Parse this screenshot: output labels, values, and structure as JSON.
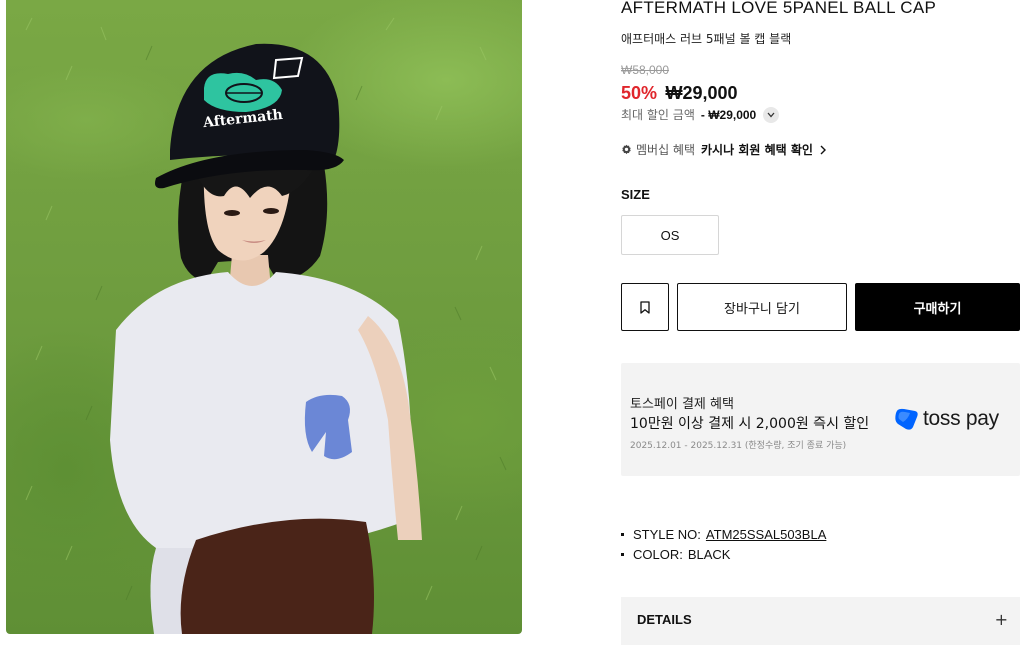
{
  "product": {
    "title": "AFTERMATH LOVE 5PANEL BALL CAP",
    "subtitle": "애프터매스 러브 5패널 볼 캡 블랙",
    "image_caption": "Aftermath"
  },
  "price": {
    "original": "₩58,000",
    "discount": "50%",
    "sale": "₩29,000",
    "max_label": "최대 할인 금액",
    "max_value": "- ₩29,000",
    "discount_color": "#e0262c"
  },
  "membership": {
    "label": "멤버십 혜택",
    "link": "카시나 회원 혜택 확인",
    "icon": "gear-icon"
  },
  "size": {
    "label": "SIZE",
    "options": [
      "OS"
    ]
  },
  "actions": {
    "wishlist_icon": "bookmark-icon",
    "cart_label": "장바구니 담기",
    "buy_label": "구매하기"
  },
  "promo": {
    "title": "토스페이 결제 혜택",
    "description": "10만원 이상 결제 시 2,000원 즉시 할인",
    "period": "2025.12.01 - 2025.12.31 (한정수량, 조기 종료 가능)",
    "brand": "toss pay",
    "brand_color": "#0064ff"
  },
  "specs": {
    "style_label": "STYLE NO:",
    "style_value": "ATM25SSAL503BLA",
    "color_label": "COLOR:",
    "color_value": "BLACK"
  },
  "details": {
    "label": "DETAILS",
    "toggle": "+"
  }
}
